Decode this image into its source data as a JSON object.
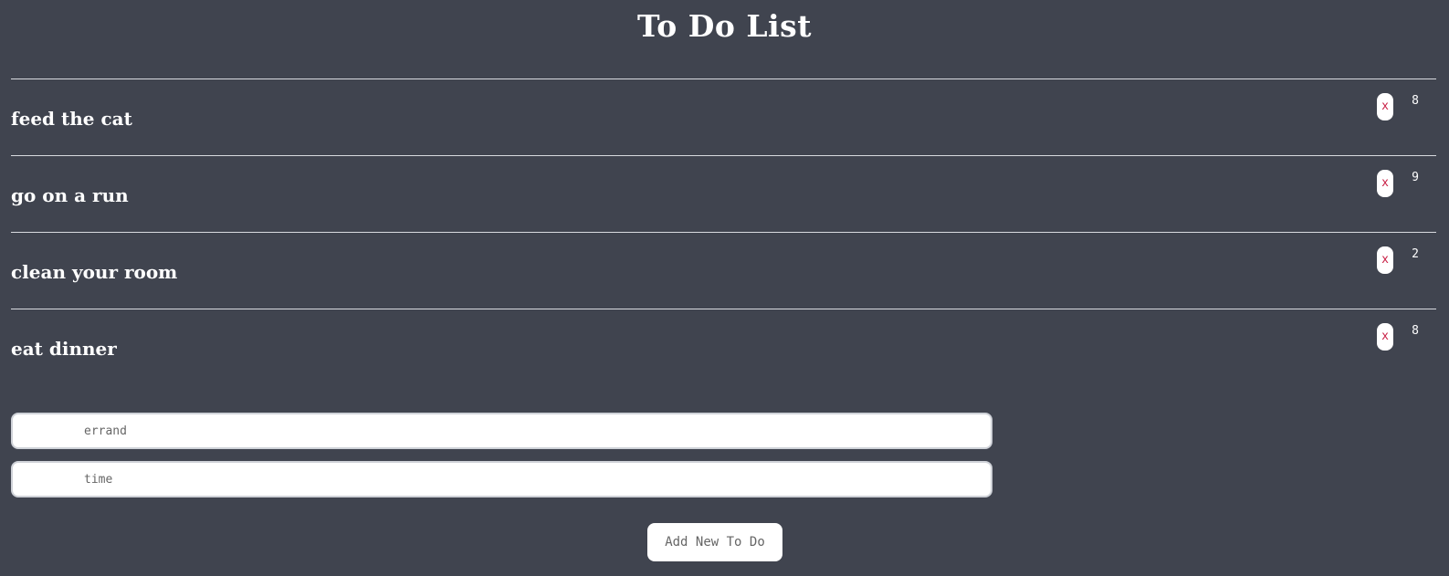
{
  "header": {
    "title": "To Do List"
  },
  "todos": [
    {
      "text": "feed the cat",
      "delete_label": "x",
      "time": "8"
    },
    {
      "text": "go on a run",
      "delete_label": "x",
      "time": "9"
    },
    {
      "text": "clean your room",
      "delete_label": "x",
      "time": "2"
    },
    {
      "text": "eat dinner",
      "delete_label": "x",
      "time": "8"
    }
  ],
  "form": {
    "errand_placeholder": "errand",
    "time_placeholder": "time",
    "add_label": "Add New To Do"
  },
  "colors": {
    "background": "#40444f",
    "text": "#ffffff",
    "delete_accent": "#c91f45",
    "divider": "#d9dbe0"
  },
  "icons": {
    "delete": "close-icon"
  }
}
